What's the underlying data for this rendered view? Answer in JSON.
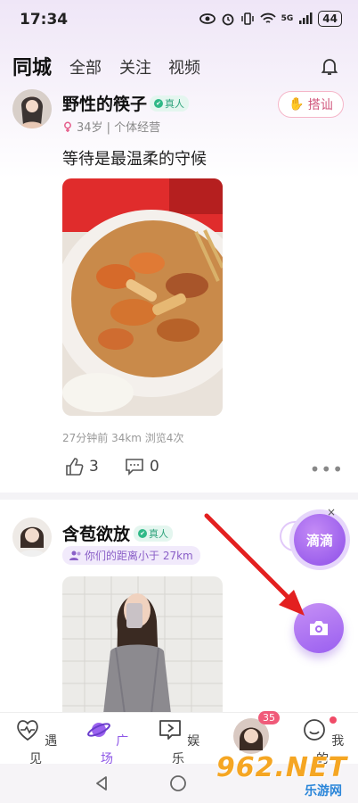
{
  "status_bar": {
    "time": "17:34",
    "battery": "44",
    "signal_label": "5G"
  },
  "nav": {
    "tabs": [
      {
        "label": "同城",
        "active": true
      },
      {
        "label": "全部",
        "active": false
      },
      {
        "label": "关注",
        "active": false
      },
      {
        "label": "视频",
        "active": false
      }
    ]
  },
  "posts": [
    {
      "username": "野性的筷子",
      "verified_label": "真人",
      "meta": "34岁 | 个体经营",
      "greet_label": "搭讪",
      "text": "等待是最温柔的守候",
      "stats": "27分钟前  34km  浏览4次",
      "likes": "3",
      "comments": "0",
      "more": "•••"
    },
    {
      "username": "含苞欲放",
      "verified_label": "真人",
      "distance": "你们的距离小于 27km"
    }
  ],
  "floating": {
    "didi_label": "滴滴",
    "close": "×"
  },
  "tabbar": {
    "items": [
      {
        "label": "遇见",
        "icon": "heart-pulse-icon"
      },
      {
        "label": "广场",
        "icon": "planet-icon",
        "active": true
      },
      {
        "label": "娱乐",
        "icon": "play-bubble-icon"
      },
      {
        "label": "",
        "icon": "avatar",
        "badge": "35"
      },
      {
        "label": "我的",
        "icon": "smile-icon"
      }
    ]
  },
  "watermark": {
    "text": "962.NET",
    "sub": "乐游网"
  },
  "colors": {
    "accent": "#8e57e7",
    "greet": "#d0557b",
    "badge": "#f05a79",
    "verified": "#2fa37c"
  }
}
